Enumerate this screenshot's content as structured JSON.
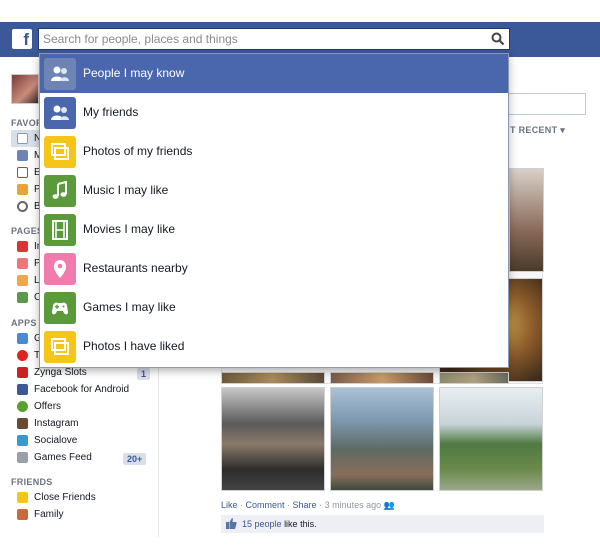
{
  "search": {
    "placeholder": "Search for people, places and things"
  },
  "dropdown": {
    "items": [
      {
        "label": "People I may know",
        "icon": "people-icon",
        "color": "#4a67ad",
        "active": true
      },
      {
        "label": "My friends",
        "icon": "friends-icon",
        "color": "#4a67ad"
      },
      {
        "label": "Photos of my friends",
        "icon": "photos-icon",
        "color": "#f5c518"
      },
      {
        "label": "Music I may like",
        "icon": "music-note-icon",
        "color": "#5b9a3b"
      },
      {
        "label": "Movies I may like",
        "icon": "film-icon",
        "color": "#5b9a3b"
      },
      {
        "label": "Restaurants nearby",
        "icon": "map-pin-icon",
        "color": "#f07bac"
      },
      {
        "label": "Games I may like",
        "icon": "gamepad-icon",
        "color": "#5b9a3b"
      },
      {
        "label": "Photos I have liked",
        "icon": "photos-icon",
        "color": "#f5c518"
      }
    ]
  },
  "sidebar": {
    "headers": {
      "favorites": "FAVOR",
      "pages": "PAGES",
      "apps": "APPS",
      "friends": "FRIENDS"
    },
    "favorites_items": [
      "N",
      "M",
      "E",
      "P",
      "B"
    ],
    "pages_items": [
      "Ir",
      "P",
      "L",
      "C"
    ],
    "apps_items": [
      {
        "label": "G",
        "icon": "app-icon"
      },
      {
        "label": "T",
        "icon": "heart-icon"
      },
      {
        "label": "Zynga Slots",
        "icon": "zynga-icon",
        "badge": "1"
      },
      {
        "label": "Facebook for Android",
        "icon": "android-icon"
      },
      {
        "label": "Offers",
        "icon": "offers-icon"
      },
      {
        "label": "Instagram",
        "icon": "instagram-icon"
      },
      {
        "label": "Socialove",
        "icon": "socialove-icon"
      },
      {
        "label": "Games Feed",
        "icon": "games-feed-icon",
        "badge": "20+"
      }
    ],
    "friends_items": [
      {
        "label": "Close Friends",
        "icon": "star-icon"
      },
      {
        "label": "Family",
        "icon": "house-icon"
      }
    ]
  },
  "feed": {
    "sort_label": "T RECENT",
    "actions": {
      "like": "Like",
      "comment": "Comment",
      "share": "Share",
      "time": "3 minutes ago"
    },
    "likes": {
      "count": "15 people",
      "suffix": "like this."
    }
  },
  "colors": {
    "brand": "#3b5998",
    "active_row": "#4a67ad"
  }
}
